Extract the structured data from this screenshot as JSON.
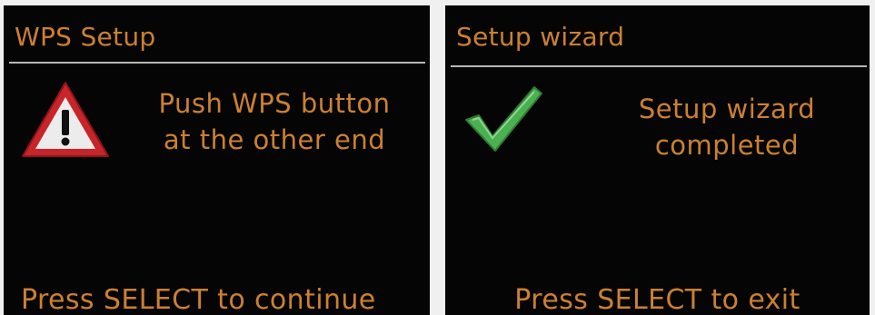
{
  "colors": {
    "screen_background": "#050505",
    "text": "#cc8031",
    "divider": "#b8b8b8",
    "warning_red": "#c8252b",
    "check_green": "#4bb04f"
  },
  "wps_screen": {
    "title": "WPS Setup",
    "icon": "warning-icon",
    "message": {
      "line1": "Push WPS button",
      "line2": "at the other end"
    },
    "footer": "Press SELECT to continue"
  },
  "wizard_screen": {
    "title": "Setup wizard",
    "icon": "check-icon",
    "message": {
      "line1": "Setup wizard",
      "line2": "completed"
    },
    "footer": "Press SELECT to exit"
  }
}
